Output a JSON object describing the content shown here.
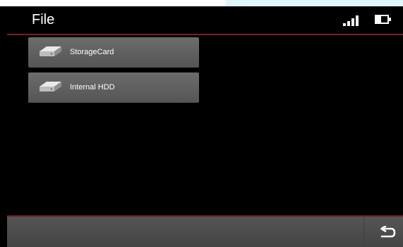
{
  "header": {
    "title": "File"
  },
  "drives": [
    {
      "label": "StorageCard",
      "icon": "hard-drive-icon"
    },
    {
      "label": "Internal HDD",
      "icon": "hard-drive-icon"
    }
  ],
  "status": {
    "signal_icon": "signal-strength-icon",
    "battery_icon": "battery-icon"
  },
  "footer": {
    "back_icon": "return-icon"
  },
  "colors": {
    "background": "#000000",
    "accent_line": "#7a1e24",
    "button_gray": "#5f5f5f",
    "text": "#ffffff"
  }
}
